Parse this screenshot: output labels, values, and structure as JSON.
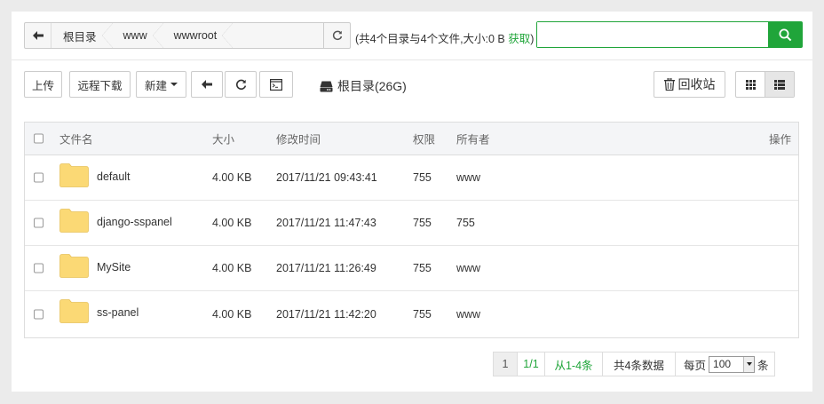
{
  "breadcrumb": [
    "根目录",
    "www",
    "wwwroot"
  ],
  "summary": {
    "text": "(共4个目录与4个文件,大小:0 B",
    "get_link": "获取",
    "close": ")"
  },
  "search": {
    "placeholder": "",
    "value": ""
  },
  "toolbar": {
    "upload": "上传",
    "remote_download": "远程下载",
    "new": "新建",
    "disk_label": "根目录(26G)",
    "recycle_bin": "回收站"
  },
  "table": {
    "headers": {
      "name": "文件名",
      "size": "大小",
      "mtime": "修改时间",
      "perm": "权限",
      "owner": "所有者",
      "ops": "操作"
    },
    "rows": [
      {
        "name": "default",
        "size": "4.00 KB",
        "mtime": "2017/11/21 09:43:41",
        "perm": "755",
        "owner": "www"
      },
      {
        "name": "django-sspanel",
        "size": "4.00 KB",
        "mtime": "2017/11/21 11:47:43",
        "perm": "755",
        "owner": "755"
      },
      {
        "name": "MySite",
        "size": "4.00 KB",
        "mtime": "2017/11/21 11:26:49",
        "perm": "755",
        "owner": "www"
      },
      {
        "name": "ss-panel",
        "size": "4.00 KB",
        "mtime": "2017/11/21 11:42:20",
        "perm": "755",
        "owner": "www"
      }
    ]
  },
  "pagination": {
    "current": "1",
    "pages": "1/1",
    "range": "从1-4条",
    "total": "共4条数据",
    "per_page_label": "每页",
    "per_page_value": "100",
    "unit": "条"
  },
  "colors": {
    "accent": "#20a53a",
    "folder": "#fbd975"
  }
}
